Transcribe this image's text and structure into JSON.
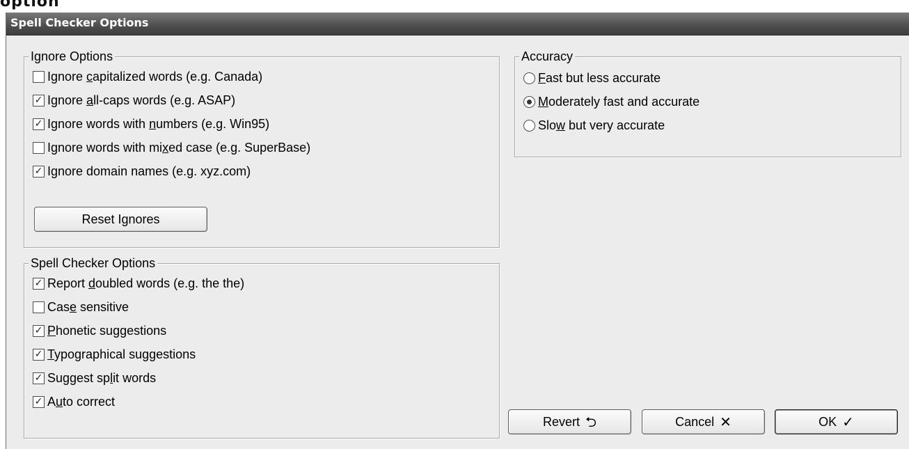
{
  "window": {
    "title": "Spell Checker Options",
    "top_fragment": "option"
  },
  "ignore_options": {
    "legend": "Ignore Options",
    "items": [
      {
        "pre": "Ignore ",
        "key": "c",
        "post": "apitalized words (e.g. Canada)",
        "checked": false
      },
      {
        "pre": "Ignore ",
        "key": "a",
        "post": "ll-caps words (e.g. ASAP)",
        "checked": true
      },
      {
        "pre": "Ignore words with ",
        "key": "n",
        "post": "umbers (e.g. Win95)",
        "checked": true
      },
      {
        "pre": "Ignore words with mi",
        "key": "x",
        "post": "ed case (e.g. SuperBase)",
        "checked": false
      },
      {
        "pre": "Ignore domain names (e.g. xyz.com)",
        "key": "",
        "post": "",
        "checked": true
      }
    ],
    "reset_button": "Reset Ignores"
  },
  "spell_options": {
    "legend": "Spell Checker Options",
    "items": [
      {
        "pre": "Report ",
        "key": "d",
        "post": "oubled words (e.g. the the)",
        "checked": true
      },
      {
        "pre": "Cas",
        "key": "e",
        "post": " sensitive",
        "checked": false
      },
      {
        "pre": "",
        "key": "P",
        "post": "honetic suggestions",
        "checked": true
      },
      {
        "pre": "",
        "key": "T",
        "post": "ypographical suggestions",
        "checked": true
      },
      {
        "pre": "Suggest sp",
        "key": "l",
        "post": "it words",
        "checked": true
      },
      {
        "pre": "A",
        "key": "u",
        "post": "to correct",
        "checked": true
      }
    ]
  },
  "accuracy": {
    "legend": "Accuracy",
    "options": [
      {
        "pre": "",
        "key": "F",
        "post": "ast but less accurate",
        "selected": false
      },
      {
        "pre": "",
        "key": "M",
        "post": "oderately fast and accurate",
        "selected": true
      },
      {
        "pre": "Slo",
        "key": "w",
        "post": " but very accurate",
        "selected": false
      }
    ]
  },
  "buttons": {
    "revert": {
      "label": "Revert",
      "icon": "revert-icon",
      "glyph": "⮌"
    },
    "cancel": {
      "label": "Cancel",
      "icon": "cancel-x-icon",
      "glyph": "✕"
    },
    "ok": {
      "label": "OK",
      "icon": "checkmark-icon",
      "glyph": "✓"
    }
  }
}
